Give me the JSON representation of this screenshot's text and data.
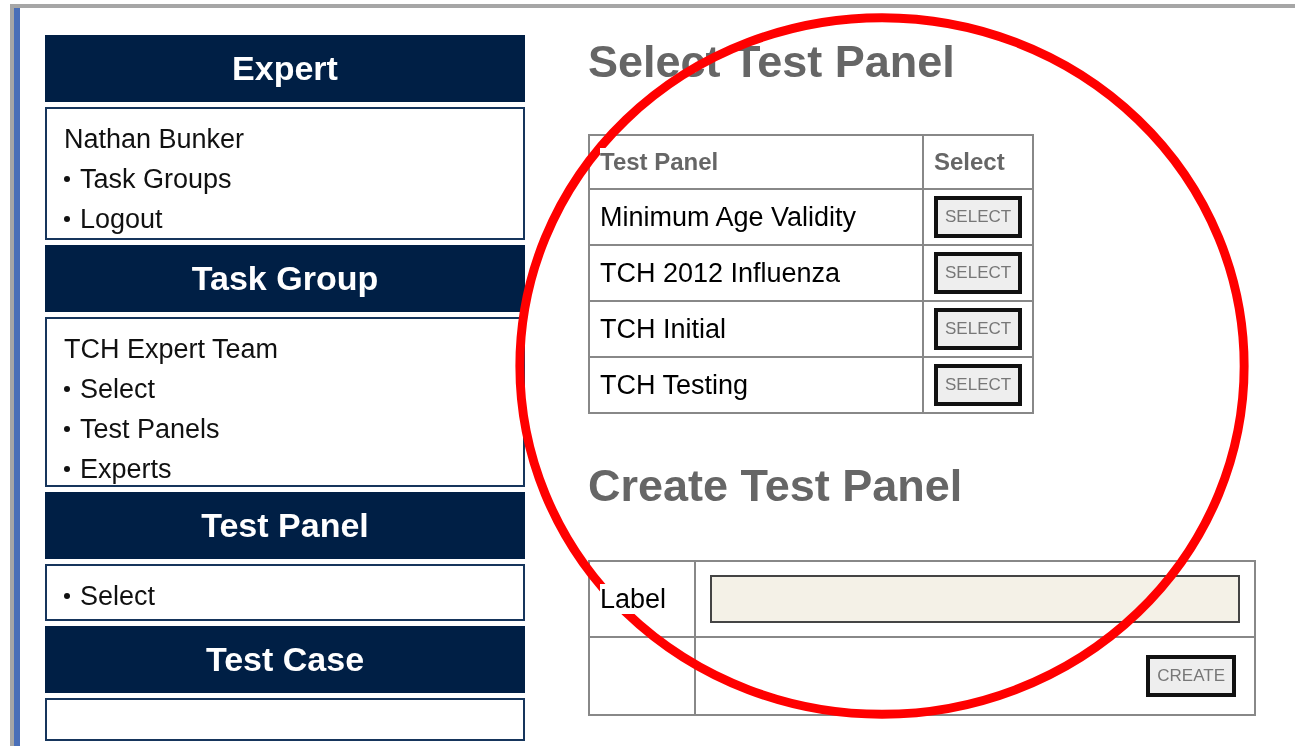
{
  "sidebar": [
    {
      "title": "Expert",
      "lines": [
        {
          "text": "Nathan Bunker",
          "kind": "plain"
        },
        {
          "text": "Task Groups",
          "kind": "link"
        },
        {
          "text": "Logout",
          "kind": "link"
        }
      ]
    },
    {
      "title": "Task Group",
      "lines": [
        {
          "text": "TCH Expert Team",
          "kind": "plain"
        },
        {
          "text": "Select",
          "kind": "link"
        },
        {
          "text": "Test Panels",
          "kind": "link"
        },
        {
          "text": "Experts",
          "kind": "link"
        }
      ]
    },
    {
      "title": "Test Panel",
      "lines": [
        {
          "text": "Select",
          "kind": "link"
        }
      ]
    },
    {
      "title": "Test Case"
    }
  ],
  "select_section": {
    "heading": "Select Test Panel",
    "columns": [
      "Test Panel",
      "Select"
    ],
    "rows": [
      {
        "name": "Minimum Age Validity",
        "button": "SELECT"
      },
      {
        "name": "TCH 2012 Influenza",
        "button": "SELECT"
      },
      {
        "name": "TCH Initial",
        "button": "SELECT"
      },
      {
        "name": "TCH Testing",
        "button": "SELECT"
      }
    ]
  },
  "create_section": {
    "heading": "Create Test Panel",
    "field_label": "Label",
    "button": "CREATE"
  }
}
